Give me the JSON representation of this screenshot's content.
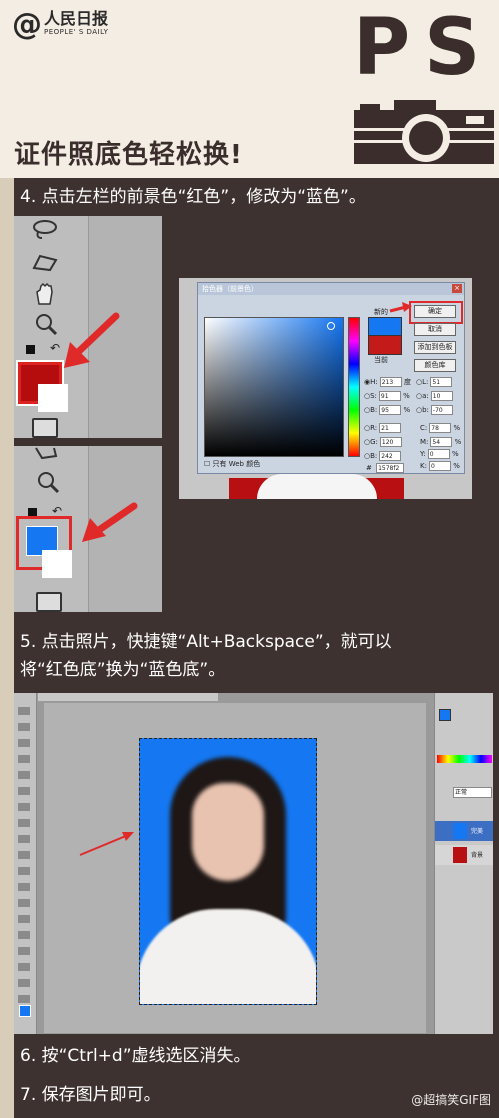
{
  "header": {
    "logo_at": "@",
    "logo_cn": "人民日报",
    "logo_en": "PEOPLE' S DAILY",
    "title": "证件照底色轻松换!",
    "ps": "PS"
  },
  "steps": {
    "s4": "4. 点击左栏的前景色“红色”，修改为“蓝色”。",
    "s5_line1": "5. 点击照片，快捷键“Alt+Backspace”，就可以",
    "s5_line2": "将“红色底”换为“蓝色底”。",
    "s6": "6. 按“Ctrl+d”虚线选区消失。",
    "s7": "7. 保存图片即可。"
  },
  "dialog": {
    "title": "拾色器（前景色）",
    "new_label": "新的",
    "current_label": "当前",
    "ok": "确定",
    "cancel": "取消",
    "add_swatch": "添加到色板",
    "color_lib": "颜色库",
    "web_only": "只有 Web 颜色",
    "H": "213",
    "S": "91",
    "B": "95",
    "R": "21",
    "G": "120",
    "Bv": "242",
    "L": "51",
    "a": "10",
    "b": "-70",
    "C": "78",
    "M": "54",
    "Y": "0",
    "K": "0",
    "hex": "1578f2",
    "unit_deg": "度",
    "unit_pct": "%"
  },
  "layers": {
    "normal": "正常",
    "layer1": "完美",
    "layer2": "背景"
  },
  "watermark": "@超搞笑GIF图",
  "colors": {
    "red": "#b50d0d",
    "blue": "#1578f2",
    "bg": "#3e3230",
    "header": "#f3ede4"
  }
}
